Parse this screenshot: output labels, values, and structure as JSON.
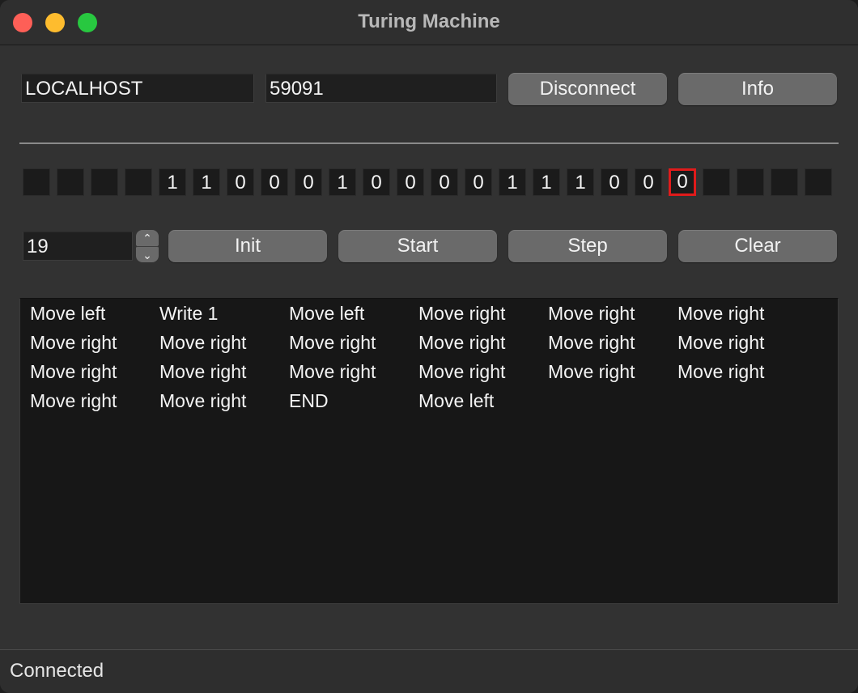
{
  "window": {
    "title": "Turing Machine"
  },
  "connection": {
    "host": "LOCALHOST",
    "port": "59091",
    "disconnect_label": "Disconnect",
    "info_label": "Info"
  },
  "tape": {
    "cells": [
      "",
      "",
      "",
      "",
      "1",
      "1",
      "0",
      "0",
      "0",
      "1",
      "0",
      "0",
      "0",
      "0",
      "1",
      "1",
      "1",
      "0",
      "0",
      "0",
      "",
      "",
      "",
      ""
    ],
    "head_index": 19,
    "head_color": "#e01b1b"
  },
  "controls": {
    "position_value": "19",
    "init_label": "Init",
    "start_label": "Start",
    "step_label": "Step",
    "clear_label": "Clear",
    "stepper_up_icon": "chevron-up-icon",
    "stepper_down_icon": "chevron-down-icon"
  },
  "log": {
    "items": [
      "Move left",
      "Write 1",
      "Move left",
      "Move right",
      "Move right",
      "Move right",
      "Move right",
      "Move right",
      "Move right",
      "Move right",
      "Move right",
      "Move right",
      "Move right",
      "Move right",
      "Move right",
      "Move right",
      "Move right",
      "Move right",
      "Move right",
      "Move right",
      "END",
      "Move left"
    ]
  },
  "status": {
    "text": "Connected"
  }
}
